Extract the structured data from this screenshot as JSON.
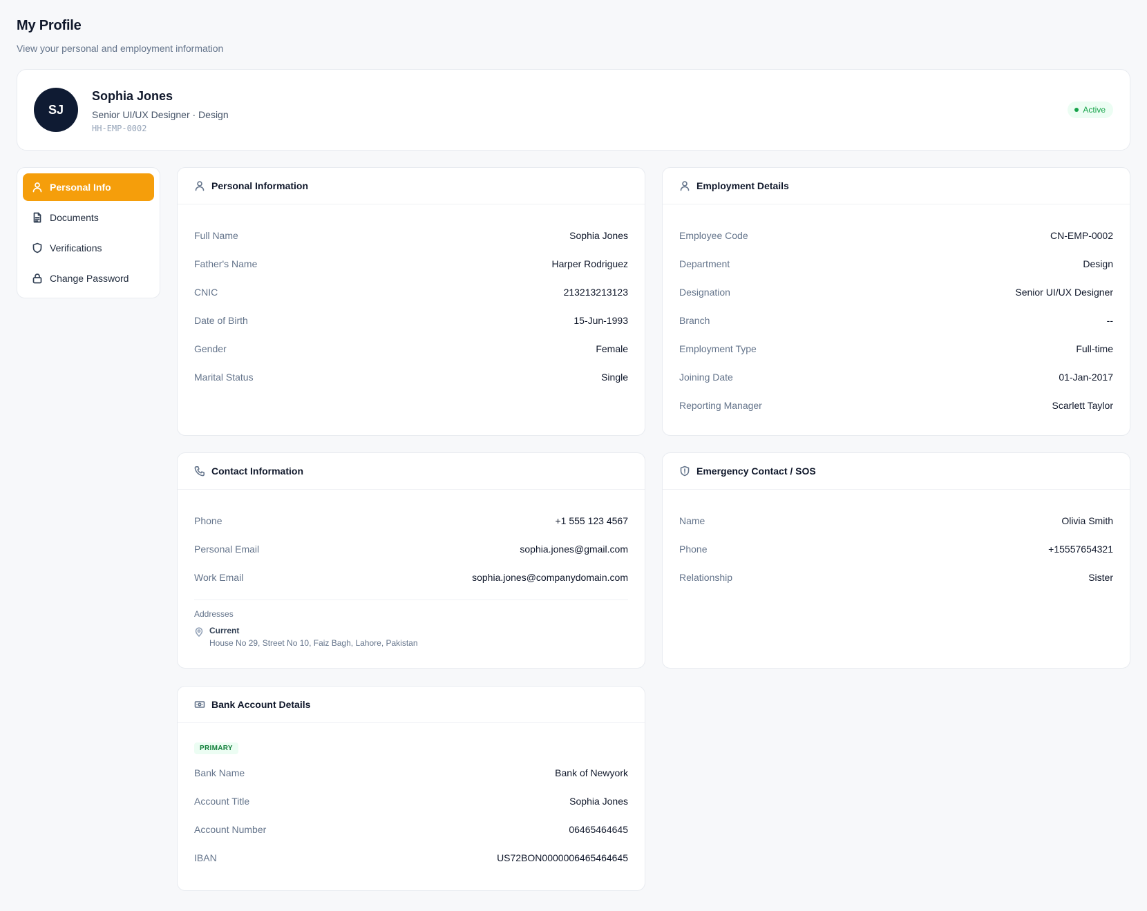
{
  "header": {
    "title": "My Profile",
    "subtitle": "View your personal and employment information"
  },
  "profile": {
    "initials": "SJ",
    "name": "Sophia Jones",
    "role_line": "Senior UI/UX Designer · Design",
    "code": "HH-EMP-0002",
    "status": "Active"
  },
  "nav": {
    "items": [
      {
        "label": "Personal Info",
        "icon": "user-icon",
        "active": true
      },
      {
        "label": "Documents",
        "icon": "document-icon",
        "active": false
      },
      {
        "label": "Verifications",
        "icon": "shield-icon",
        "active": false
      },
      {
        "label": "Change Password",
        "icon": "lock-icon",
        "active": false
      }
    ]
  },
  "personal": {
    "title": "Personal Information",
    "rows": [
      {
        "label": "Full Name",
        "value": "Sophia Jones"
      },
      {
        "label": "Father's Name",
        "value": "Harper Rodriguez"
      },
      {
        "label": "CNIC",
        "value": "213213213123"
      },
      {
        "label": "Date of Birth",
        "value": "15-Jun-1993"
      },
      {
        "label": "Gender",
        "value": "Female"
      },
      {
        "label": "Marital Status",
        "value": "Single"
      }
    ]
  },
  "employment": {
    "title": "Employment Details",
    "rows": [
      {
        "label": "Employee Code",
        "value": "CN-EMP-0002"
      },
      {
        "label": "Department",
        "value": "Design"
      },
      {
        "label": "Designation",
        "value": "Senior UI/UX Designer"
      },
      {
        "label": "Branch",
        "value": "--"
      },
      {
        "label": "Employment Type",
        "value": "Full-time"
      },
      {
        "label": "Joining Date",
        "value": "01-Jan-2017"
      },
      {
        "label": "Reporting Manager",
        "value": "Scarlett Taylor"
      }
    ]
  },
  "contact": {
    "title": "Contact Information",
    "rows": [
      {
        "label": "Phone",
        "value": "+1 555 123 4567"
      },
      {
        "label": "Personal Email",
        "value": "sophia.jones@gmail.com"
      },
      {
        "label": "Work Email",
        "value": "sophia.jones@companydomain.com"
      }
    ],
    "addresses_label": "Addresses",
    "address": {
      "type": "Current",
      "text": "House No 29, Street No 10, Faiz Bagh, Lahore, Pakistan"
    }
  },
  "emergency": {
    "title": "Emergency Contact / SOS",
    "rows": [
      {
        "label": "Name",
        "value": "Olivia Smith"
      },
      {
        "label": "Phone",
        "value": "+15557654321"
      },
      {
        "label": "Relationship",
        "value": "Sister"
      }
    ]
  },
  "bank": {
    "title": "Bank Account Details",
    "badge": "PRIMARY",
    "rows": [
      {
        "label": "Bank Name",
        "value": "Bank of Newyork"
      },
      {
        "label": "Account Title",
        "value": "Sophia Jones"
      },
      {
        "label": "Account Number",
        "value": "06465464645"
      },
      {
        "label": "IBAN",
        "value": "US72BON0000006465464645"
      }
    ]
  },
  "colors": {
    "accent": "#f59e0b",
    "avatar_bg": "#0f1b33",
    "status_green": "#16a34a"
  }
}
